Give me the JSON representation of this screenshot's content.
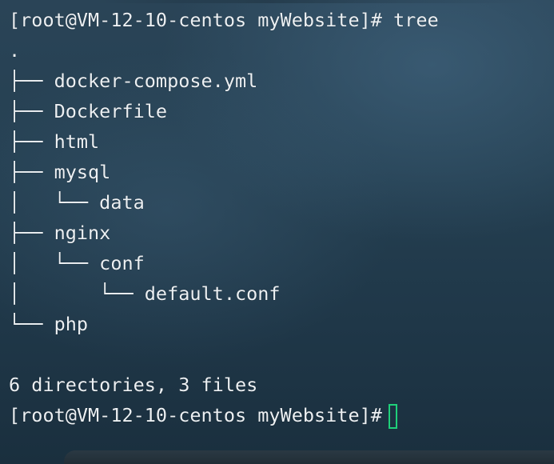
{
  "terminal": {
    "lines": [
      "[root@VM-12-10-centos myWebsite]# tree",
      ".",
      "├── docker-compose.yml",
      "├── Dockerfile",
      "├── html",
      "├── mysql",
      "│   └── data",
      "├── nginx",
      "│   └── conf",
      "│       └── default.conf",
      "└── php",
      "",
      "6 directories, 3 files",
      "[root@VM-12-10-centos myWebsite]# "
    ],
    "cursor_color": "#1fd07a",
    "text_color": "#ecf0f3"
  }
}
